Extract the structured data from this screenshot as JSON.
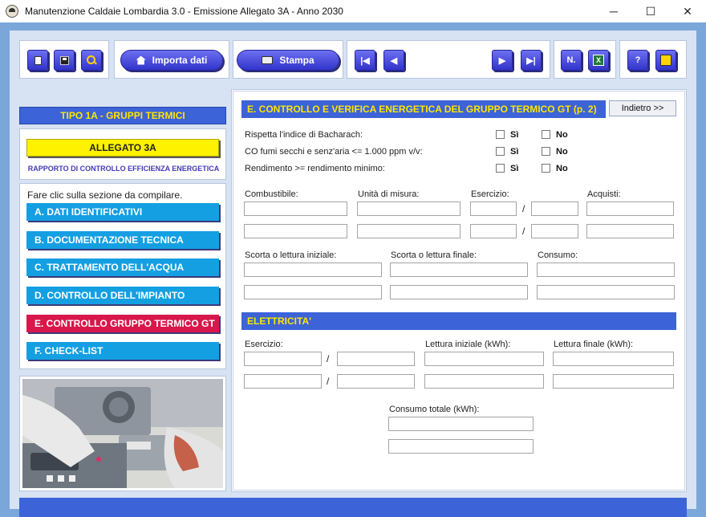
{
  "window": {
    "title": "Manutenzione Caldaie Lombardia 3.0 - Emissione Allegato 3A - Anno 2030",
    "minimize": "─",
    "maximize": "☐",
    "close": "✕"
  },
  "toolbar": {
    "import_label": "Importa dati",
    "print_label": "Stampa",
    "first": "|◀",
    "prev": "◀",
    "next": "▶",
    "last": "▶|",
    "number_label": "N.",
    "excel": "X",
    "help": "?",
    "icons": [
      "new-document-icon",
      "save-icon",
      "search-icon",
      "home-icon",
      "printer-icon",
      "excel-icon",
      "help-icon",
      "exit-icon"
    ]
  },
  "sidebar": {
    "tipo": "TIPO 1A - GRUPPI TERMICI",
    "allegato_label": "ALLEGATO 3A",
    "allegato_sub": "RAPPORTO DI CONTROLLO EFFICIENZA ENERGETICA",
    "hint": "Fare clic sulla sezione da compilare.",
    "sections": [
      {
        "label": "A. DATI IDENTIFICATIVI",
        "active": false
      },
      {
        "label": "B. DOCUMENTAZIONE TECNICA",
        "active": false
      },
      {
        "label": "C. TRATTAMENTO DELL'ACQUA",
        "active": false
      },
      {
        "label": "D. CONTROLLO DELL'IMPIANTO",
        "active": false
      },
      {
        "label": "E. CONTROLLO GRUPPO TERMICO GT",
        "active": true
      },
      {
        "label": "F. CHECK-LIST",
        "active": false
      }
    ]
  },
  "main": {
    "header": "E. CONTROLLO E VERIFICA ENERGETICA DEL GRUPPO TERMICO GT (p. 2)",
    "back_label": "Indietro >>",
    "yes_label": "Sì",
    "no_label": "No",
    "questions": [
      {
        "label": "Rispetta l'indice di Bacharach:",
        "yes": false,
        "no": false
      },
      {
        "label": "CO fumi secchi e senz'aria <= 1.000 ppm v/v:",
        "yes": false,
        "no": false
      },
      {
        "label": "Rendimento >= rendimento minimo:",
        "yes": false,
        "no": false
      }
    ],
    "fuel": {
      "combustibile": "Combustibile:",
      "unita": "Unità di misura:",
      "esercizio": "Esercizio:",
      "acquisti": "Acquisti:",
      "separator": "/"
    },
    "stock": {
      "iniziale": "Scorta o lettura iniziale:",
      "finale": "Scorta o lettura finale:",
      "consumo": "Consumo:"
    },
    "elec": {
      "header": "ELETTRICITA'",
      "esercizio": "Esercizio:",
      "lettura_iniziale": "Lettura iniziale (kWh):",
      "lettura_finale": "Lettura finale (kWh):",
      "consumo_totale": "Consumo totale (kWh):",
      "separator": "/"
    }
  },
  "colors": {
    "frame": "#7aa6d9",
    "panel": "#d7e2f3",
    "accent_blue": "#3c63d8",
    "header_text": "#ffe600",
    "section_button": "#149fe2",
    "section_active": "#d8174b",
    "allegato_yellow": "#fff200"
  }
}
